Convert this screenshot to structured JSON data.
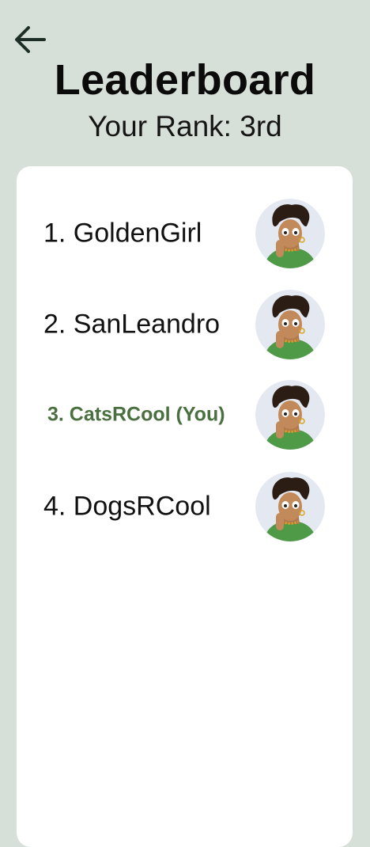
{
  "header": {
    "back_icon": "arrow-left-icon",
    "title": "Leaderboard",
    "rank_text": "Your Rank: 3rd"
  },
  "leaderboard": {
    "entries": [
      {
        "label": "1. GoldenGirl",
        "avatar_icon": "user-avatar",
        "is_you": false
      },
      {
        "label": "2. SanLeandro",
        "avatar_icon": "user-avatar",
        "is_you": false
      },
      {
        "label": "3. CatsRCool (You)",
        "avatar_icon": "user-avatar",
        "is_you": true
      },
      {
        "label": "4. DogsRCool",
        "avatar_icon": "user-avatar",
        "is_you": false
      }
    ]
  },
  "colors": {
    "background": "#d7e0d8",
    "card": "#ffffff",
    "you_highlight": "#4a7040",
    "text": "#111111"
  }
}
